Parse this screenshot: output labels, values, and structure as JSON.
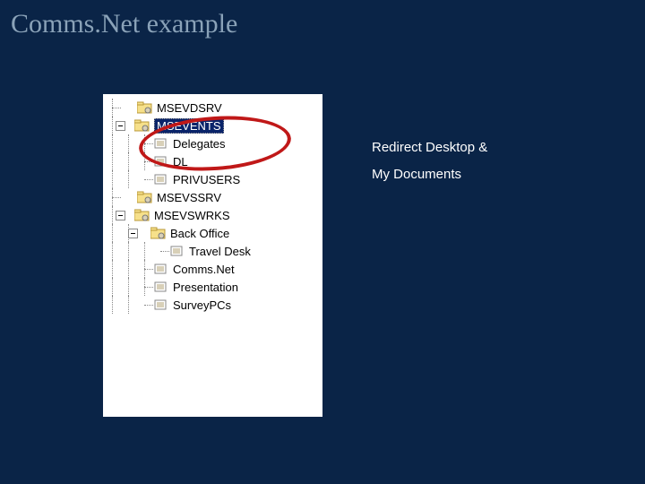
{
  "title": "Comms.Net example",
  "annotation": {
    "line1": "Redirect Desktop &",
    "line2": "My Documents"
  },
  "tree": {
    "items": [
      "MSEVDSRV",
      "MSEVENTS",
      "Delegates",
      "DL",
      "PRIVUSERS",
      "MSEVSSRV",
      "MSEVSWRKS",
      "Back Office",
      "Travel Desk",
      "Comms.Net",
      "Presentation",
      "SurveyPCs"
    ]
  }
}
